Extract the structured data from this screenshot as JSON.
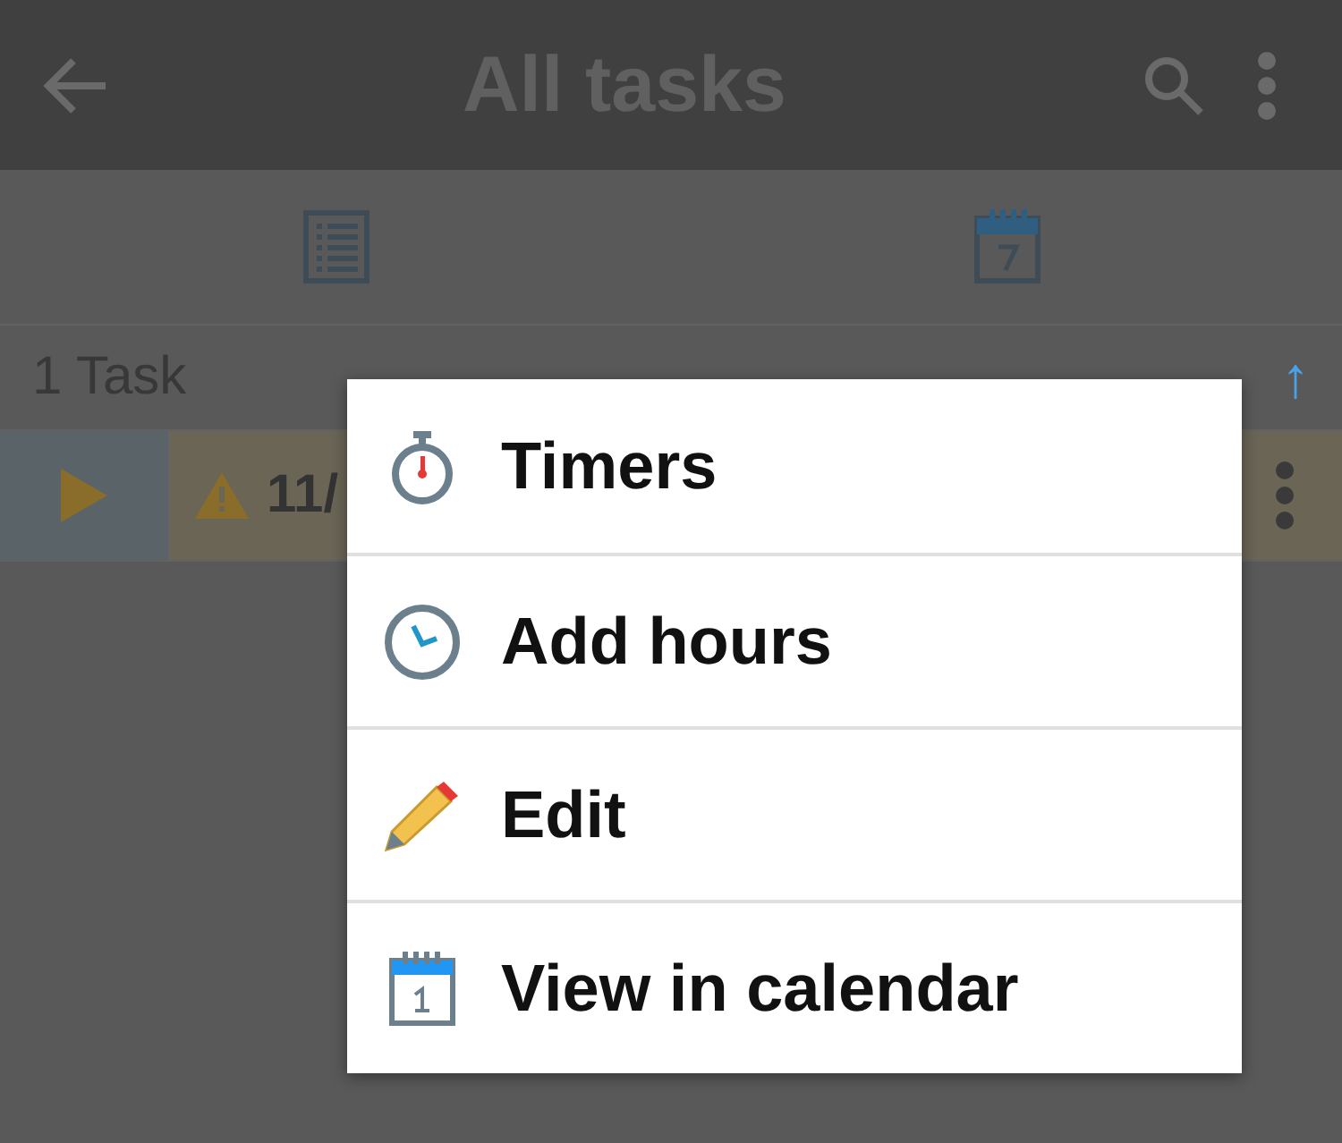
{
  "app_bar": {
    "title": "All tasks"
  },
  "view_tabs": [
    {
      "kind": "list",
      "selected": false
    },
    {
      "kind": "calendar",
      "selected": false
    }
  ],
  "list_header": {
    "count": "1 Task",
    "sort_arrow": "↑"
  },
  "tasks": [
    {
      "title": "11/",
      "overdue": true
    }
  ],
  "context_menu": {
    "items": [
      {
        "kind": "timer",
        "label": "Timers"
      },
      {
        "kind": "clock",
        "label": "Add hours"
      },
      {
        "kind": "pencil",
        "label": "Edit"
      },
      {
        "kind": "calendar",
        "label": "View in calendar"
      }
    ]
  }
}
